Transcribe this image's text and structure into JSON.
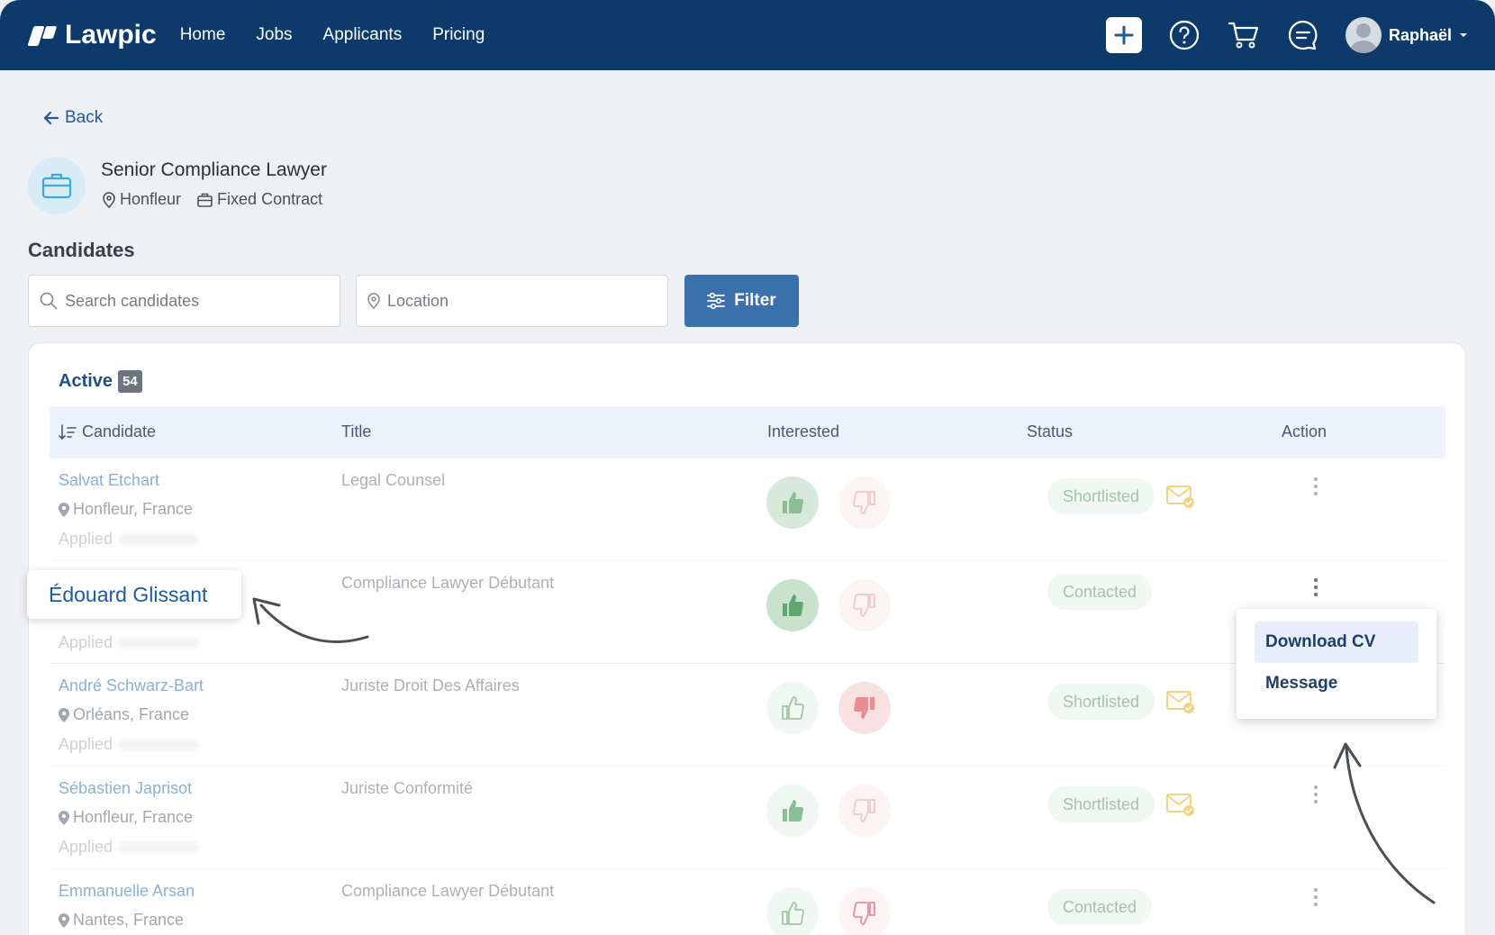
{
  "app": {
    "brand": "Lawpic"
  },
  "nav": {
    "links": [
      "Home",
      "Jobs",
      "Applicants",
      "Pricing"
    ],
    "user_name": "Raphaël"
  },
  "page": {
    "back_label": "Back",
    "job_title": "Senior Compliance Lawyer",
    "job_location": "Honfleur",
    "job_contract": "Fixed Contract",
    "section_title": "Candidates"
  },
  "search": {
    "placeholder": "Search candidates"
  },
  "location": {
    "placeholder": "Location"
  },
  "filter": {
    "label": "Filter"
  },
  "tabs": {
    "active_label": "Active",
    "active_count": "54"
  },
  "table": {
    "columns": [
      "Candidate",
      "Title",
      "Interested",
      "Status",
      "Action"
    ],
    "applied_label": "Applied",
    "rows": [
      {
        "name": "Salvat Etchart",
        "location": "Honfleur, France",
        "title": "Legal Counsel",
        "interested": "up",
        "status": "Shortlisted",
        "mail": true
      },
      {
        "name": "Édouard Glissant",
        "location": "",
        "title": "Compliance Lawyer Débutant",
        "interested": "up-strong",
        "status": "Contacted",
        "mail": false
      },
      {
        "name": "André Schwarz-Bart",
        "location": "Orléans, France",
        "title": "Juriste Droit Des Affaires",
        "interested": "down",
        "status": "Shortlisted",
        "mail": true
      },
      {
        "name": "Sébastien Japrisot",
        "location": "Honfleur, France",
        "title": "Juriste Conformité",
        "interested": "up",
        "status": "Shortlisted",
        "mail": true
      },
      {
        "name": "Emmanuelle Arsan",
        "location": "Nantes, France",
        "title": "Compliance Lawyer Débutant",
        "interested": "none",
        "status": "Contacted",
        "mail": false
      }
    ]
  },
  "dropdown": {
    "items": [
      "Download CV",
      "Message"
    ]
  },
  "colors": {
    "primary": "#0c3a6b",
    "accent": "#1e5a9e",
    "status_green": "#5b8f67",
    "thumb_down": "#e0505a"
  }
}
